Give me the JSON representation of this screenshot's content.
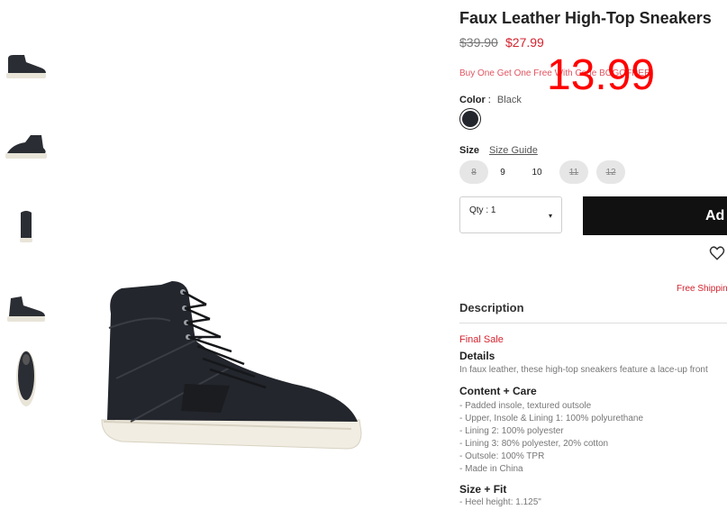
{
  "product": {
    "title": "Faux Leather High-Top Sneakers",
    "original_price": "$39.90",
    "sale_price": "$27.99",
    "promo_text": "Buy One Get One Free With Code BOGOFREE",
    "overlay_price": "13.99"
  },
  "color": {
    "label": "Color",
    "separator": ":",
    "value": "Black",
    "swatch_hex": "#23262c"
  },
  "size": {
    "label": "Size",
    "guide_label": "Size Guide",
    "options": [
      {
        "label": "8",
        "available": false
      },
      {
        "label": "9",
        "available": true
      },
      {
        "label": "10",
        "available": true
      },
      {
        "label": "11",
        "available": false
      },
      {
        "label": "12",
        "available": false
      }
    ]
  },
  "qty": {
    "label": "Qty : 1",
    "caret": "▾"
  },
  "cart": {
    "add_label": "Ad"
  },
  "shipping": {
    "text": "Free Shippin"
  },
  "description": {
    "heading": "Description",
    "final_sale": "Final Sale",
    "details_title": "Details",
    "details_text": "In faux leather, these high-top sneakers feature a lace-up front",
    "care_title": "Content + Care",
    "care_items": [
      "- Padded insole, textured outsole",
      "- Upper, Insole & Lining 1: 100% polyurethane",
      "- Lining 2: 100% polyester",
      "- Lining 3: 80% polyester, 20% cotton",
      "- Outsole: 100% TPR",
      "- Made in China"
    ],
    "fit_title": "Size + Fit",
    "fit_text": "- Heel height: 1.125\""
  },
  "colors": {
    "sale_red": "#d4242f",
    "overlay_red": "#ff0000",
    "button_black": "#111111"
  }
}
